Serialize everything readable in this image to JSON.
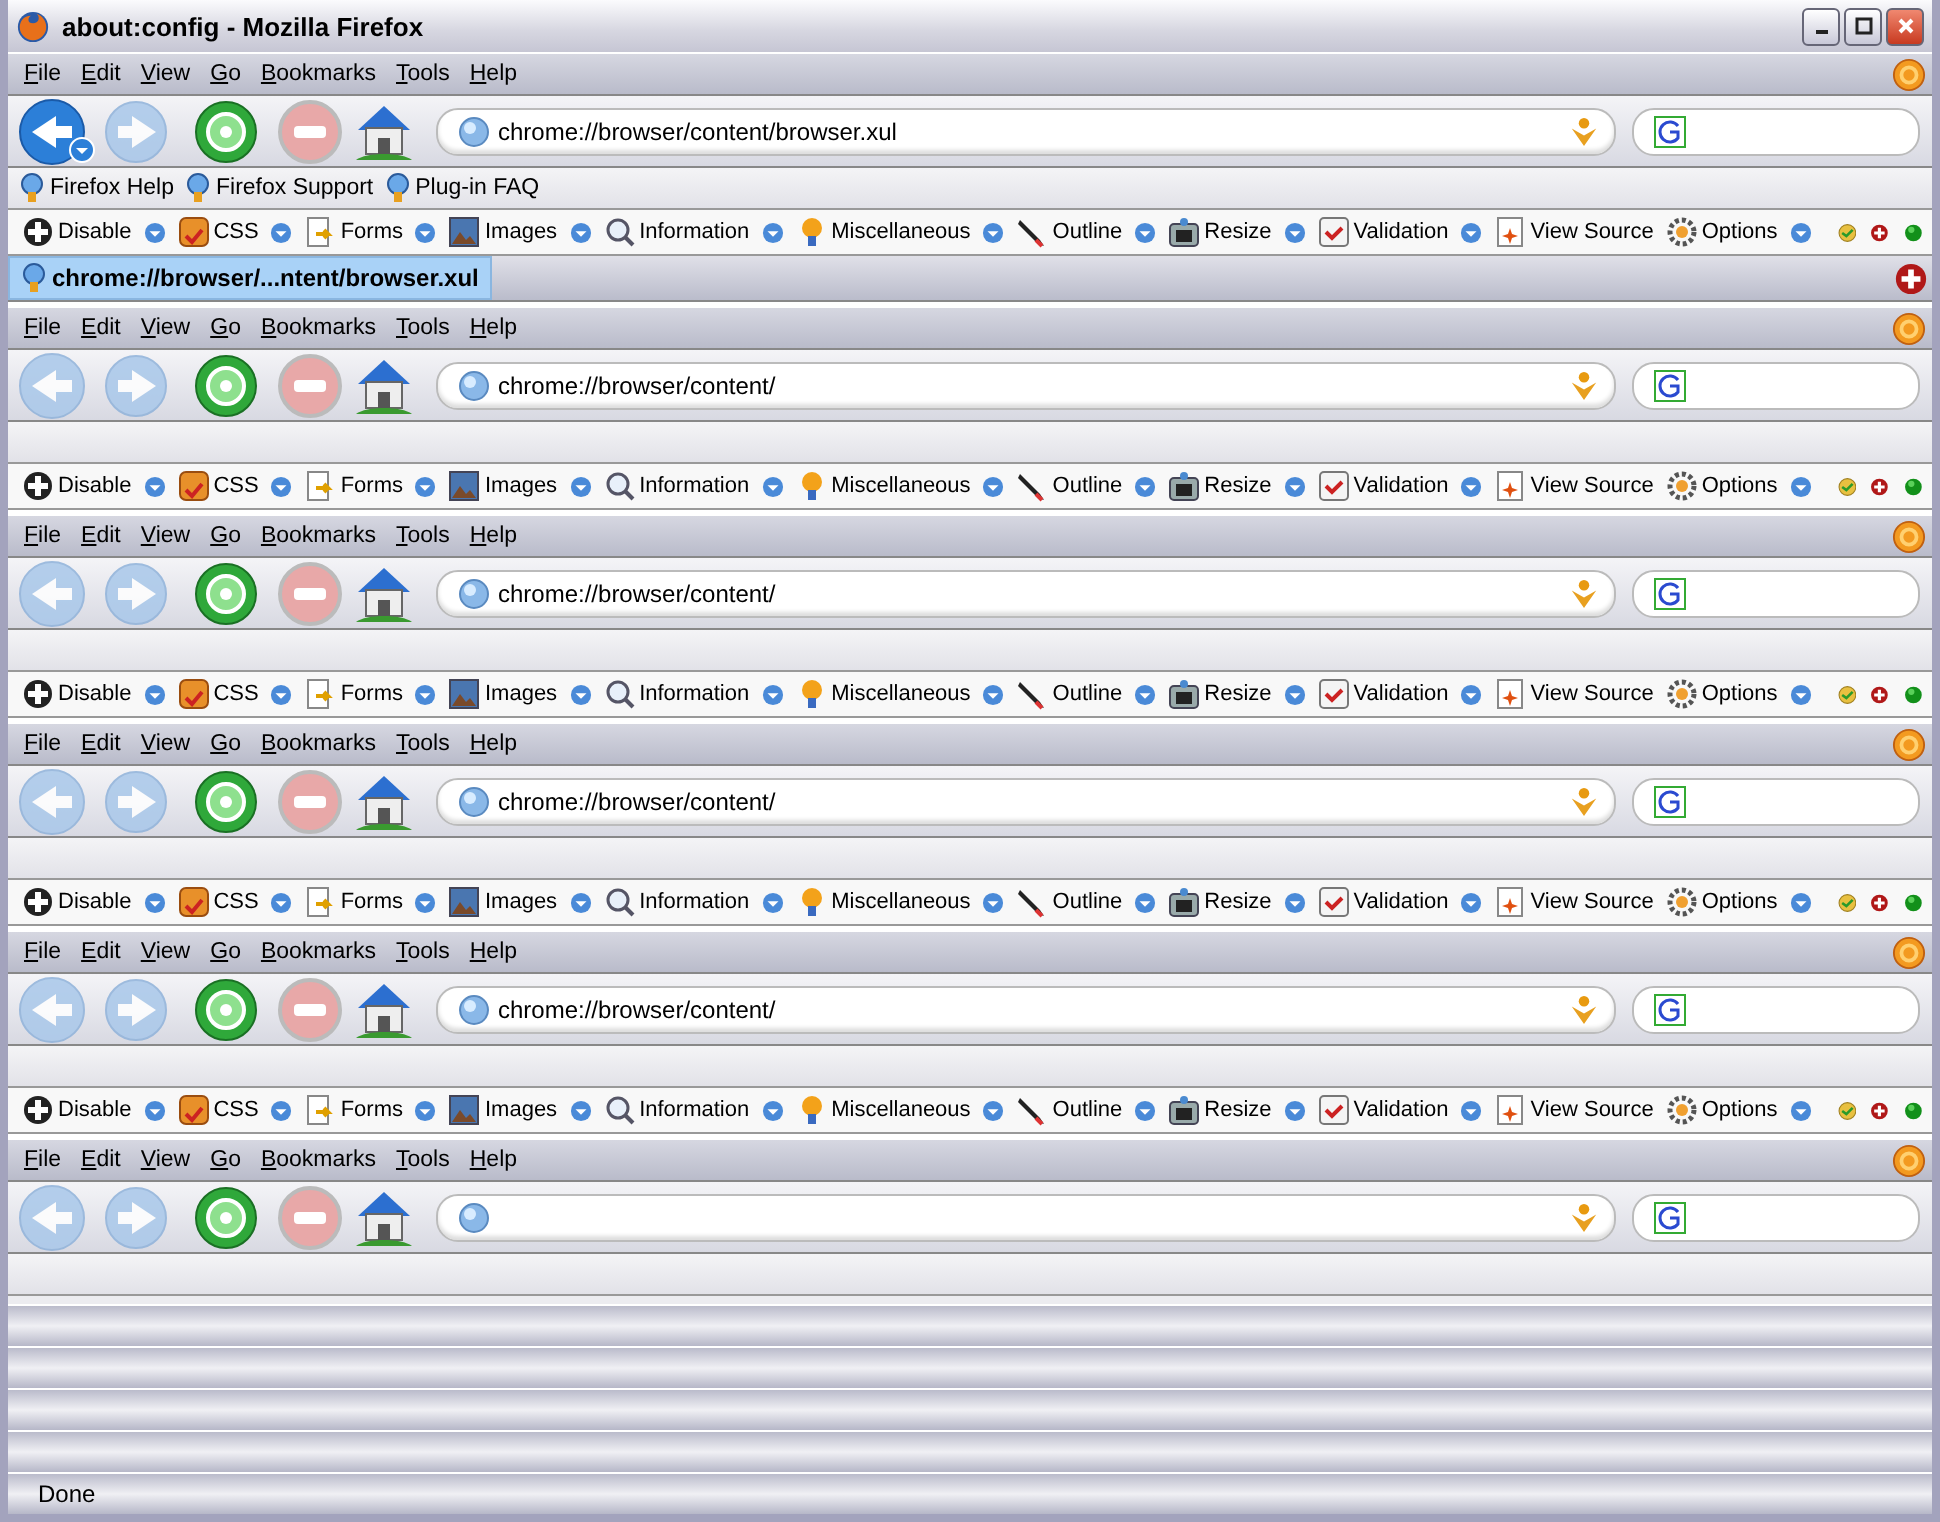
{
  "window": {
    "title": "about:config - Mozilla Firefox"
  },
  "frames": [
    {
      "menu": [
        "File",
        "Edit",
        "View",
        "Go",
        "Bookmarks",
        "Tools",
        "Help"
      ],
      "nav": {
        "back_disabled": false,
        "back_has_menu": true,
        "forward_disabled": true,
        "stop_disabled": true,
        "url": "chrome://browser/content/browser.xul"
      },
      "bookmarks": [
        {
          "label": "Firefox Help"
        },
        {
          "label": "Firefox Support"
        },
        {
          "label": "Plug-in FAQ"
        }
      ],
      "webdev": [
        {
          "label": "Disable",
          "has_menu": true
        },
        {
          "label": "CSS",
          "has_menu": true
        },
        {
          "label": "Forms",
          "has_menu": true
        },
        {
          "label": "Images",
          "has_menu": true
        },
        {
          "label": "Information",
          "has_menu": true
        },
        {
          "label": "Miscellaneous",
          "has_menu": true
        },
        {
          "label": "Outline",
          "has_menu": true
        },
        {
          "label": "Resize",
          "has_menu": true
        },
        {
          "label": "Validation",
          "has_menu": true
        },
        {
          "label": "View Source",
          "has_menu": false
        },
        {
          "label": "Options",
          "has_menu": true
        }
      ],
      "tabs": [
        {
          "label": "chrome://browser/...ntent/browser.xul",
          "selected": true
        }
      ]
    },
    {
      "menu": [
        "File",
        "Edit",
        "View",
        "Go",
        "Bookmarks",
        "Tools",
        "Help"
      ],
      "nav": {
        "back_disabled": true,
        "back_has_menu": false,
        "forward_disabled": true,
        "stop_disabled": true,
        "url": "chrome://browser/content/"
      },
      "webdev": [
        {
          "label": "Disable",
          "has_menu": true
        },
        {
          "label": "CSS",
          "has_menu": true
        },
        {
          "label": "Forms",
          "has_menu": true
        },
        {
          "label": "Images",
          "has_menu": true
        },
        {
          "label": "Information",
          "has_menu": true
        },
        {
          "label": "Miscellaneous",
          "has_menu": true
        },
        {
          "label": "Outline",
          "has_menu": true
        },
        {
          "label": "Resize",
          "has_menu": true
        },
        {
          "label": "Validation",
          "has_menu": true
        },
        {
          "label": "View Source",
          "has_menu": false
        },
        {
          "label": "Options",
          "has_menu": true
        }
      ]
    },
    {
      "menu": [
        "File",
        "Edit",
        "View",
        "Go",
        "Bookmarks",
        "Tools",
        "Help"
      ],
      "nav": {
        "back_disabled": true,
        "back_has_menu": false,
        "forward_disabled": true,
        "stop_disabled": true,
        "url": "chrome://browser/content/"
      },
      "webdev": [
        {
          "label": "Disable",
          "has_menu": true
        },
        {
          "label": "CSS",
          "has_menu": true
        },
        {
          "label": "Forms",
          "has_menu": true
        },
        {
          "label": "Images",
          "has_menu": true
        },
        {
          "label": "Information",
          "has_menu": true
        },
        {
          "label": "Miscellaneous",
          "has_menu": true
        },
        {
          "label": "Outline",
          "has_menu": true
        },
        {
          "label": "Resize",
          "has_menu": true
        },
        {
          "label": "Validation",
          "has_menu": true
        },
        {
          "label": "View Source",
          "has_menu": false
        },
        {
          "label": "Options",
          "has_menu": true
        }
      ]
    },
    {
      "menu": [
        "File",
        "Edit",
        "View",
        "Go",
        "Bookmarks",
        "Tools",
        "Help"
      ],
      "nav": {
        "back_disabled": true,
        "back_has_menu": false,
        "forward_disabled": true,
        "stop_disabled": true,
        "url": "chrome://browser/content/"
      },
      "webdev": [
        {
          "label": "Disable",
          "has_menu": true
        },
        {
          "label": "CSS",
          "has_menu": true
        },
        {
          "label": "Forms",
          "has_menu": true
        },
        {
          "label": "Images",
          "has_menu": true
        },
        {
          "label": "Information",
          "has_menu": true
        },
        {
          "label": "Miscellaneous",
          "has_menu": true
        },
        {
          "label": "Outline",
          "has_menu": true
        },
        {
          "label": "Resize",
          "has_menu": true
        },
        {
          "label": "Validation",
          "has_menu": true
        },
        {
          "label": "View Source",
          "has_menu": false
        },
        {
          "label": "Options",
          "has_menu": true
        }
      ]
    },
    {
      "menu": [
        "File",
        "Edit",
        "View",
        "Go",
        "Bookmarks",
        "Tools",
        "Help"
      ],
      "nav": {
        "back_disabled": true,
        "back_has_menu": false,
        "forward_disabled": true,
        "stop_disabled": true,
        "url": "chrome://browser/content/"
      },
      "webdev": [
        {
          "label": "Disable",
          "has_menu": true
        },
        {
          "label": "CSS",
          "has_menu": true
        },
        {
          "label": "Forms",
          "has_menu": true
        },
        {
          "label": "Images",
          "has_menu": true
        },
        {
          "label": "Information",
          "has_menu": true
        },
        {
          "label": "Miscellaneous",
          "has_menu": true
        },
        {
          "label": "Outline",
          "has_menu": true
        },
        {
          "label": "Resize",
          "has_menu": true
        },
        {
          "label": "Validation",
          "has_menu": true
        },
        {
          "label": "View Source",
          "has_menu": false
        },
        {
          "label": "Options",
          "has_menu": true
        }
      ]
    },
    {
      "menu": [
        "File",
        "Edit",
        "View",
        "Go",
        "Bookmarks",
        "Tools",
        "Help"
      ],
      "nav": {
        "back_disabled": true,
        "back_has_menu": false,
        "forward_disabled": true,
        "stop_disabled": true
      }
    }
  ],
  "status_bars": [
    {
      "kind": "empty"
    },
    {
      "kind": "empty"
    },
    {
      "kind": "empty"
    },
    {
      "kind": "empty"
    },
    {
      "kind": "text",
      "text": "Done"
    }
  ]
}
